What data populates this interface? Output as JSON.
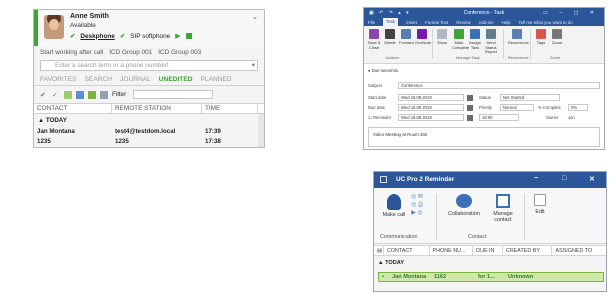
{
  "colors": {
    "uc_green": "#3fa336",
    "office_blue": "#2b579a",
    "reminder_row_bg": "#cfe8a9",
    "reminder_row_text": "#2e7d32"
  },
  "client": {
    "user_name": "Anne Smith",
    "status": "Available",
    "devices": {
      "desk": "Deskphone",
      "soft": "SIP softphone"
    },
    "collapse_glyph": "⌄",
    "work_items": [
      "Start working after call",
      "ICD Group 001",
      "ICD Group 003"
    ],
    "search_placeholder": "Enter a search term or a phone number!",
    "tabs": [
      "FAVORITES",
      "SEARCH",
      "JOURNAL",
      "UNEDITED",
      "PLANNED"
    ],
    "filter_label": "Filter",
    "columns": [
      "CONTACT",
      "REMOTE STATION",
      "TIME"
    ],
    "group": "▲ TODAY",
    "rows": [
      {
        "contact": "Jan Montana",
        "station": "test4@testdom.local",
        "time": "17:39"
      },
      {
        "contact": "1235",
        "station": "1235",
        "time": "17:38"
      }
    ]
  },
  "task": {
    "window_title": "Conference - Task",
    "quick_access": "▣ ↶ ↷ ▴ ▾",
    "window_controls": "▭ − ▢ ✕",
    "menu": [
      "File",
      "Task",
      "Insert",
      "Format Text",
      "Review",
      "Add-ins",
      "Help",
      "Tell me what you want to do"
    ],
    "active_menu": "Task",
    "ribbon_buttons": [
      "Save & Close",
      "Delete",
      "Forward",
      "OneNote",
      "Show",
      "Mark Complete",
      "Assign Task",
      "Send Status Report",
      "Recurrence",
      "Tags",
      "Zoom"
    ],
    "ribbon_groups": [
      "Actions",
      "Manage Task",
      "Recurrence",
      "Zoom"
    ],
    "info": "Due tomorrow.",
    "subject_label": "Subject",
    "subject": "Conference",
    "start_label": "Start date",
    "start_value": "Wed 16.09.2019",
    "due_label": "Due date",
    "due_value": "Wed 16.09.2019",
    "reminder_label": "Reminder",
    "reminder_value": "Wed 16.09.2019",
    "reminder_time": "15:00",
    "status_label": "Status",
    "status_value": "Not Started",
    "priority_label": "Priority",
    "priority_value": "Normal",
    "complete_label": "% Complete",
    "complete_value": "0%",
    "owner_label": "Owner",
    "owner_value": "Jon",
    "notes": "Video Meeting at Room 302"
  },
  "reminder": {
    "title": "UC Pro 2 Reminder",
    "window_controls": [
      "−",
      "□",
      "✕"
    ],
    "buttons": [
      "Make call",
      "Collaboration",
      "Manage contact",
      "Edit"
    ],
    "groups": [
      "Communication",
      "Contact"
    ],
    "columns": [
      "CONTACT",
      "PHONE NU...",
      "DUE IN",
      "CREATED BY",
      "ASSIGNED TO"
    ],
    "group": "▲ TODAY",
    "row": {
      "contact": "Jan Montana",
      "phone": "1162",
      "due_in": "for 1...",
      "created_by": "Unknown"
    }
  }
}
